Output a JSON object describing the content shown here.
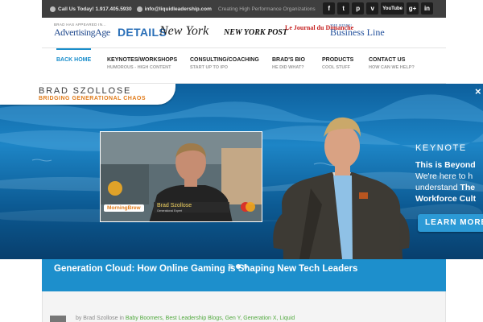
{
  "topbar": {
    "phone": "Call Us Today! 1.917.405.5930",
    "email": "info@liquidleadership.com",
    "tagline": "Creating High Performance Organizations",
    "socials": [
      "f",
      "t",
      "p",
      "v",
      "YouTube",
      "g+",
      "in"
    ]
  },
  "press": {
    "label": "BRAD HAS APPEARED IN...",
    "logos": [
      "AdvertisingAge",
      "DETAILS",
      "New York",
      "NEW YORK POST",
      "Le Journal du Dimanche",
      "Business Line"
    ],
    "business_line_small": "THE HINDU"
  },
  "nav": {
    "items": [
      {
        "label": "BACK HOME",
        "sub": ""
      },
      {
        "label": "KEYNOTES/WORKSHOPS",
        "sub": "HUMOROUS - HIGH CONTENT"
      },
      {
        "label": "CONSULTING/COACHING",
        "sub": "START UP TO IPO"
      },
      {
        "label": "BRAD'S BIO",
        "sub": "HE DID WHAT?"
      },
      {
        "label": "PRODUCTS",
        "sub": "COOL STUFF"
      },
      {
        "label": "CONTACT US",
        "sub": "HOW CAN WE HELP?"
      }
    ]
  },
  "hero": {
    "brand": "BRAD SZOLLOSE",
    "brand_sub": "BRIDGING GENERATIONAL CHAOS",
    "heading": "KEYNOTE",
    "line1": "This is Beyond",
    "line2": "We're here to h",
    "line3_pre": "understand ",
    "line3_bold": "The",
    "line4": "Workforce Cult",
    "button": "LEARN MORE",
    "close": "×",
    "video": {
      "show_logo": "MorningBrew",
      "lower_third_name": "Brad Szollose",
      "lower_third_title": "Generational Expert",
      "card_label": "MasterCard"
    }
  },
  "post": {
    "title": "Generation Cloud: How Online Gaming is Shaping New Tech Leaders",
    "author": "by Brad Szollose",
    "in_label": "in",
    "categories": "Baby Boomers, Best Leadership Blogs, Gen Y, Generation X, Liquid"
  },
  "colors": {
    "accent": "#1a8ecb",
    "topbar": "#3f3f3f",
    "orange": "#e07a18",
    "sea": "#0f6fae"
  }
}
